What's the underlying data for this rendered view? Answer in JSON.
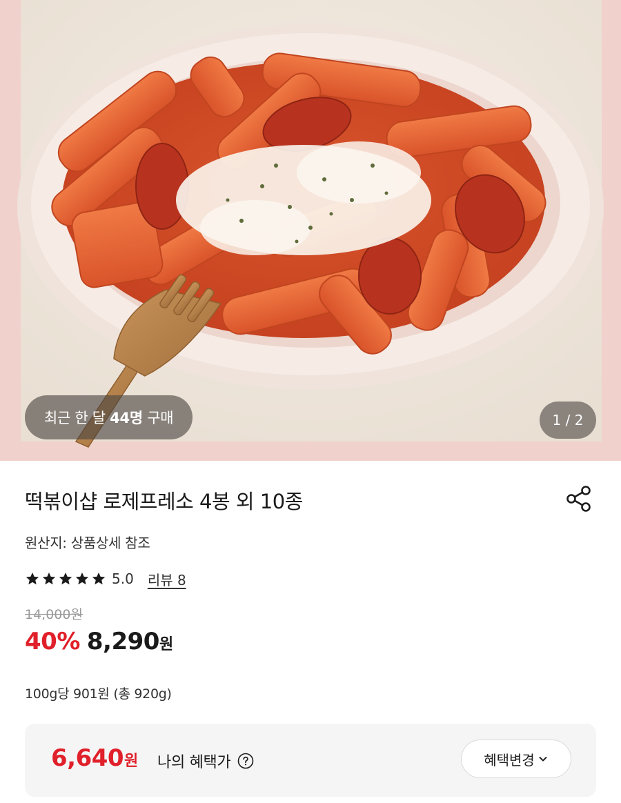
{
  "hero": {
    "purchase_prefix": "최근 한 달 ",
    "purchase_count": "44명",
    "purchase_suffix": " 구매",
    "image_counter": "1 / 2"
  },
  "product": {
    "title": "떡볶이샵 로제프레소 4봉 외 10종",
    "origin": "원산지: 상품상세 참조",
    "rating": {
      "stars": 5,
      "value": "5.0",
      "review_label": "리뷰 8"
    },
    "original_price": "14,000원",
    "discount": "40%",
    "price": "8,290",
    "currency": "원",
    "unit_price": "100g당 901원 (총 920g)"
  },
  "benefit": {
    "price": "6,640",
    "currency": "원",
    "label": "나의 혜택가",
    "change_button": "혜택변경"
  },
  "icons": {
    "share": "share-icon",
    "help": "question-circle-icon",
    "chevron": "chevron-down-icon",
    "star": "star-icon"
  },
  "colors": {
    "accent_red": "#e0202a",
    "text_dark": "#1a1a1a",
    "muted": "#9a9a9a",
    "benefit_bg": "#f5f5f6",
    "hero_border": "#f1d1cb"
  }
}
